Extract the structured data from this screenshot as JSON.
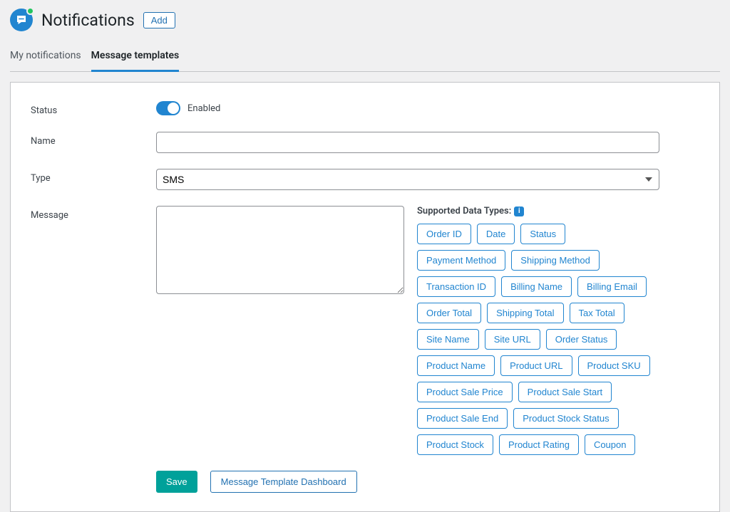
{
  "page": {
    "title": "Notifications",
    "add_label": "Add"
  },
  "tabs": {
    "my_notifications": "My notifications",
    "message_templates": "Message templates",
    "active": "message_templates"
  },
  "form": {
    "status": {
      "label": "Status",
      "value_label": "Enabled",
      "enabled": true
    },
    "name": {
      "label": "Name",
      "value": ""
    },
    "type": {
      "label": "Type",
      "value": "SMS"
    },
    "message": {
      "label": "Message",
      "value": ""
    },
    "data_types": {
      "title": "Supported Data Types:",
      "info_glyph": "i",
      "items": [
        "Order ID",
        "Date",
        "Status",
        "Payment Method",
        "Shipping Method",
        "Transaction ID",
        "Billing Name",
        "Billing Email",
        "Order Total",
        "Shipping Total",
        "Tax Total",
        "Site Name",
        "Site URL",
        "Order Status",
        "Product Name",
        "Product URL",
        "Product SKU",
        "Product Sale Price",
        "Product Sale Start",
        "Product Sale End",
        "Product Stock Status",
        "Product Stock",
        "Product Rating",
        "Coupon"
      ]
    },
    "actions": {
      "save": "Save",
      "dashboard": "Message Template Dashboard"
    }
  }
}
